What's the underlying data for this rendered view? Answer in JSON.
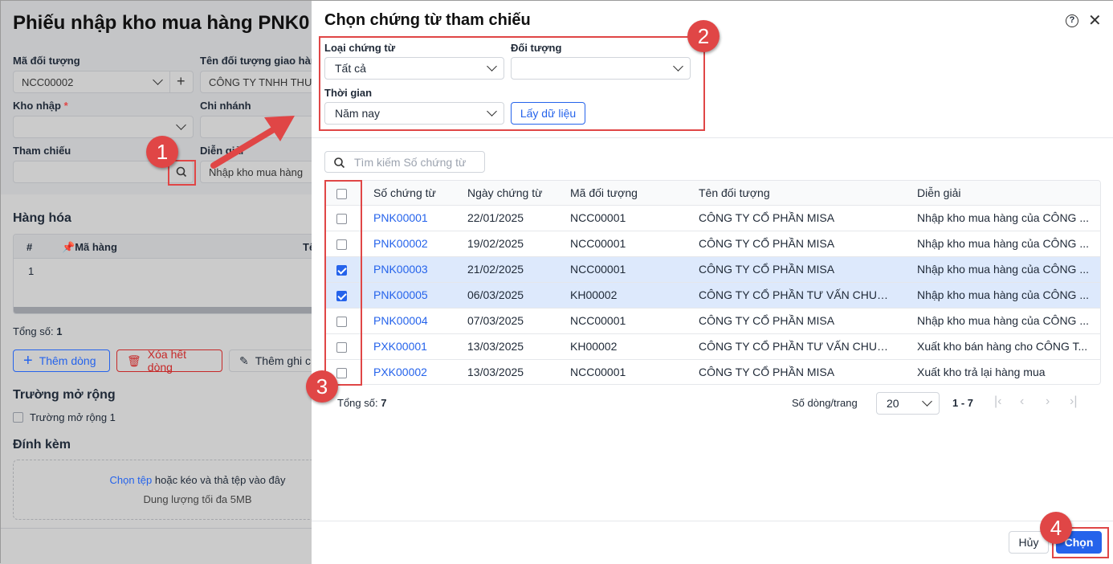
{
  "page": {
    "title": "Phiếu nhập kho mua hàng PNK0",
    "ma_doi_tuong_label": "Mã đối tượng",
    "ma_doi_tuong_value": "NCC00002",
    "ten_doi_tuong_label": "Tên đối tượng giao hàn",
    "ten_doi_tuong_value": "CÔNG TY TNHH THU",
    "kho_nhap_label": "Kho nhập",
    "required_mark": "*",
    "chi_nhanh_label": "Chi nhánh",
    "tham_chieu_label": "Tham chiếu",
    "dien_giai_label": "Diễn giải",
    "dien_giai_value": "Nhập kho mua hàng",
    "hang_hoa_title": "Hàng hóa",
    "col_index": "#",
    "col_ma_hang": "Mã hàng",
    "col_ten": "Tê",
    "row_index": "1",
    "total_label": "Tổng số:",
    "total_value": "1",
    "add_row": "Thêm dòng",
    "delete_rows": "Xóa hết dòng",
    "add_note": "Thêm ghi c",
    "ext_title": "Trường mở rộng",
    "ext_field": "Trường mở rộng 1",
    "attach_title": "Đính kèm",
    "attach_link": "Chọn tệp",
    "attach_text": "hoặc kéo và thả tệp vào đây",
    "attach_limit": "Dung lượng tối đa 5MB"
  },
  "modal": {
    "title": "Chọn chứng từ tham chiếu",
    "loai_label": "Loại chứng từ",
    "loai_value": "Tất cả",
    "doi_tuong_label": "Đối tượng",
    "doi_tuong_value": "",
    "thoi_gian_label": "Thời gian",
    "thoi_gian_value": "Năm nay",
    "fetch_button": "Lấy dữ liệu",
    "search_placeholder": "Tìm kiếm Số chứng từ",
    "columns": [
      "Số chứng từ",
      "Ngày chứng từ",
      "Mã đối tượng",
      "Tên đối tượng",
      "Diễn giải"
    ],
    "rows": [
      {
        "so": "PNK00001",
        "ngay": "22/01/2025",
        "ma": "NCC00001",
        "ten": "CÔNG TY CỔ PHẦN MISA",
        "dien_giai": "Nhập kho mua hàng của CÔNG ...",
        "checked": false
      },
      {
        "so": "PNK00002",
        "ngay": "19/02/2025",
        "ma": "NCC00001",
        "ten": "CÔNG TY CỔ PHẦN MISA",
        "dien_giai": "Nhập kho mua hàng của CÔNG ...",
        "checked": false
      },
      {
        "so": "PNK00003",
        "ngay": "21/02/2025",
        "ma": "NCC00001",
        "ten": "CÔNG TY CỔ PHẦN MISA",
        "dien_giai": "Nhập kho mua hàng của CÔNG ...",
        "checked": true
      },
      {
        "so": "PNK00005",
        "ngay": "06/03/2025",
        "ma": "KH00002",
        "ten": "CÔNG TY CỔ PHẦN TƯ VẤN CHUYÊ...",
        "dien_giai": "Nhập kho mua hàng của CÔNG ...",
        "checked": true
      },
      {
        "so": "PNK00004",
        "ngay": "07/03/2025",
        "ma": "NCC00001",
        "ten": "CÔNG TY CỔ PHẦN MISA",
        "dien_giai": "Nhập kho mua hàng của CÔNG ...",
        "checked": false
      },
      {
        "so": "PXK00001",
        "ngay": "13/03/2025",
        "ma": "KH00002",
        "ten": "CÔNG TY CỔ PHẦN TƯ VẤN CHUYÊ...",
        "dien_giai": "Xuất kho bán hàng cho CÔNG T...",
        "checked": false
      },
      {
        "so": "PXK00002",
        "ngay": "13/03/2025",
        "ma": "NCC00001",
        "ten": "CÔNG TY CỔ PHẦN MISA",
        "dien_giai": "Xuất kho trả lại hàng mua",
        "checked": false
      }
    ],
    "total_label": "Tổng số:",
    "total_value": "7",
    "page_size_label": "Số dòng/trang",
    "page_size": "20",
    "range": "1 - 7",
    "cancel": "Hủy",
    "choose": "Chọn"
  },
  "annotations": [
    "1",
    "2",
    "3",
    "4"
  ],
  "colors": {
    "primary": "#2563eb",
    "danger": "#e04646",
    "selected_row": "#dde9fc"
  }
}
